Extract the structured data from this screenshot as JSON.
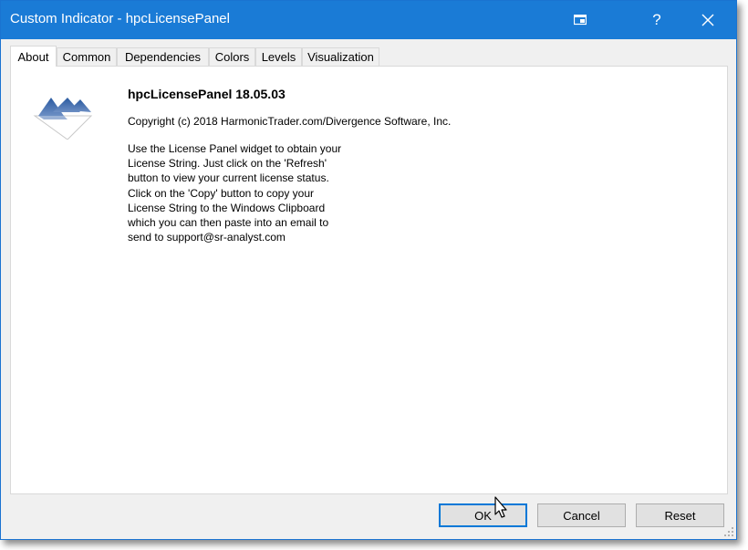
{
  "window": {
    "title": "Custom Indicator - hpcLicensePanel",
    "help_label": "?",
    "colors": {
      "titlebar": "#1a7bd6",
      "accent": "#0078d7"
    }
  },
  "tabs": [
    {
      "label": "About",
      "active": true
    },
    {
      "label": "Common",
      "active": false
    },
    {
      "label": "Dependencies",
      "active": false
    },
    {
      "label": "Colors",
      "active": false
    },
    {
      "label": "Levels",
      "active": false
    },
    {
      "label": "Visualization",
      "active": false
    }
  ],
  "about": {
    "product": "hpcLicensePanel 18.05.03",
    "copyright": "Copyright (c) 2018 HarmonicTrader.com/Divergence Software, Inc.",
    "description_lines": [
      "Use the License Panel widget to obtain your",
      "License String. Just click on the 'Refresh'",
      "button to view your current license status.",
      "Click on the 'Copy' button to copy your",
      "License String to the Windows Clipboard",
      "which you can then paste into an email to",
      "send to support@sr-analyst.com"
    ]
  },
  "buttons": {
    "ok": "OK",
    "cancel": "Cancel",
    "reset": "Reset"
  },
  "icons": {
    "logo": "mountain-logo-icon",
    "pin": "pin-window-icon",
    "close": "close-icon",
    "grip": "resize-grip-icon",
    "cursor": "mouse-cursor-icon"
  }
}
